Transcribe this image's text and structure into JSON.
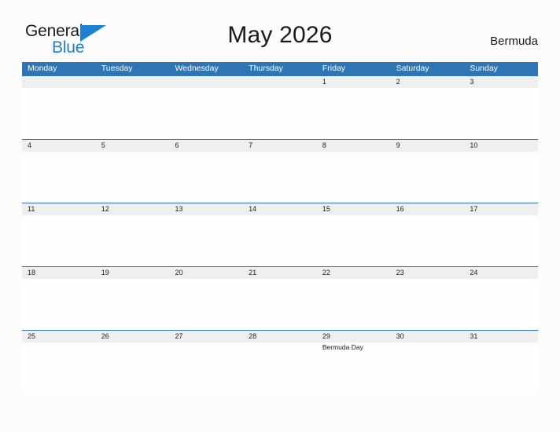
{
  "brand": {
    "name_part1": "General",
    "name_part2": "Blue",
    "flag_icon": "blue-flag-triangle",
    "color_primary": "#2e75b6",
    "color_logo_blue": "#1f7fd0"
  },
  "header": {
    "title": "May 2026",
    "region": "Bermuda"
  },
  "calendar": {
    "month": "May",
    "year": "2026",
    "weekday_headers": [
      "Monday",
      "Tuesday",
      "Wednesday",
      "Thursday",
      "Friday",
      "Saturday",
      "Sunday"
    ],
    "weeks": [
      {
        "days": [
          {
            "date": "",
            "events": []
          },
          {
            "date": "",
            "events": []
          },
          {
            "date": "",
            "events": []
          },
          {
            "date": "",
            "events": []
          },
          {
            "date": "1",
            "events": []
          },
          {
            "date": "2",
            "events": []
          },
          {
            "date": "3",
            "events": []
          }
        ]
      },
      {
        "days": [
          {
            "date": "4",
            "events": []
          },
          {
            "date": "5",
            "events": []
          },
          {
            "date": "6",
            "events": []
          },
          {
            "date": "7",
            "events": []
          },
          {
            "date": "8",
            "events": []
          },
          {
            "date": "9",
            "events": []
          },
          {
            "date": "10",
            "events": []
          }
        ]
      },
      {
        "days": [
          {
            "date": "11",
            "events": []
          },
          {
            "date": "12",
            "events": []
          },
          {
            "date": "13",
            "events": []
          },
          {
            "date": "14",
            "events": []
          },
          {
            "date": "15",
            "events": []
          },
          {
            "date": "16",
            "events": []
          },
          {
            "date": "17",
            "events": []
          }
        ]
      },
      {
        "days": [
          {
            "date": "18",
            "events": []
          },
          {
            "date": "19",
            "events": []
          },
          {
            "date": "20",
            "events": []
          },
          {
            "date": "21",
            "events": []
          },
          {
            "date": "22",
            "events": []
          },
          {
            "date": "23",
            "events": []
          },
          {
            "date": "24",
            "events": []
          }
        ]
      },
      {
        "days": [
          {
            "date": "25",
            "events": []
          },
          {
            "date": "26",
            "events": []
          },
          {
            "date": "27",
            "events": []
          },
          {
            "date": "28",
            "events": []
          },
          {
            "date": "29",
            "events": [
              "Bermuda Day"
            ]
          },
          {
            "date": "30",
            "events": []
          },
          {
            "date": "31",
            "events": []
          }
        ]
      }
    ]
  }
}
